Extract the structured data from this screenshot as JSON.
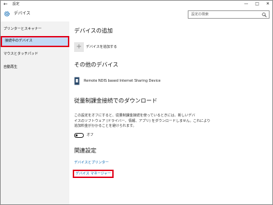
{
  "titlebar": {
    "back": "←",
    "title": "設定",
    "minimize": "—",
    "maximize": "□",
    "close": "✕"
  },
  "header": {
    "icon": "gear-icon",
    "title": "デバイス",
    "search_placeholder": "設定の検索",
    "search_icon": "search-icon"
  },
  "sidebar": {
    "items": [
      {
        "label": "プリンターとスキャナー"
      },
      {
        "label": "接続中のデバイス"
      },
      {
        "label": "マウスとタッチパッド"
      },
      {
        "label": "自動再生"
      }
    ],
    "selected_index": 1
  },
  "main": {
    "add_heading": "デバイスの追加",
    "add_button_glyph": "+",
    "add_label": "デバイスを追加する",
    "other_heading": "その他のデバイス",
    "device_icon": "usb-device-icon",
    "device_name": "Remote NDIS based Internet Sharing Device",
    "metered_heading": "従量制課金接続でのダウンロード",
    "metered_desc": [
      "この設定をオフにすると、従量制課金接続を使っているときには、新しいデバ",
      "イスのソフトウェア (ドライバー、情報、アプリ) をダウンロードしません。これにより",
      "追加料金がかかることを避けられます。"
    ],
    "toggle_state": "オフ",
    "related_heading": "関連設定",
    "link_devices_printers": "デバイスとプリンター",
    "link_device_manager": "デバイス マネージャー"
  },
  "colors": {
    "highlight": "#e1001a",
    "selected_bg": "#c3daf5",
    "link": "#0063b1",
    "sidebar_bg": "#f2f2f2"
  }
}
